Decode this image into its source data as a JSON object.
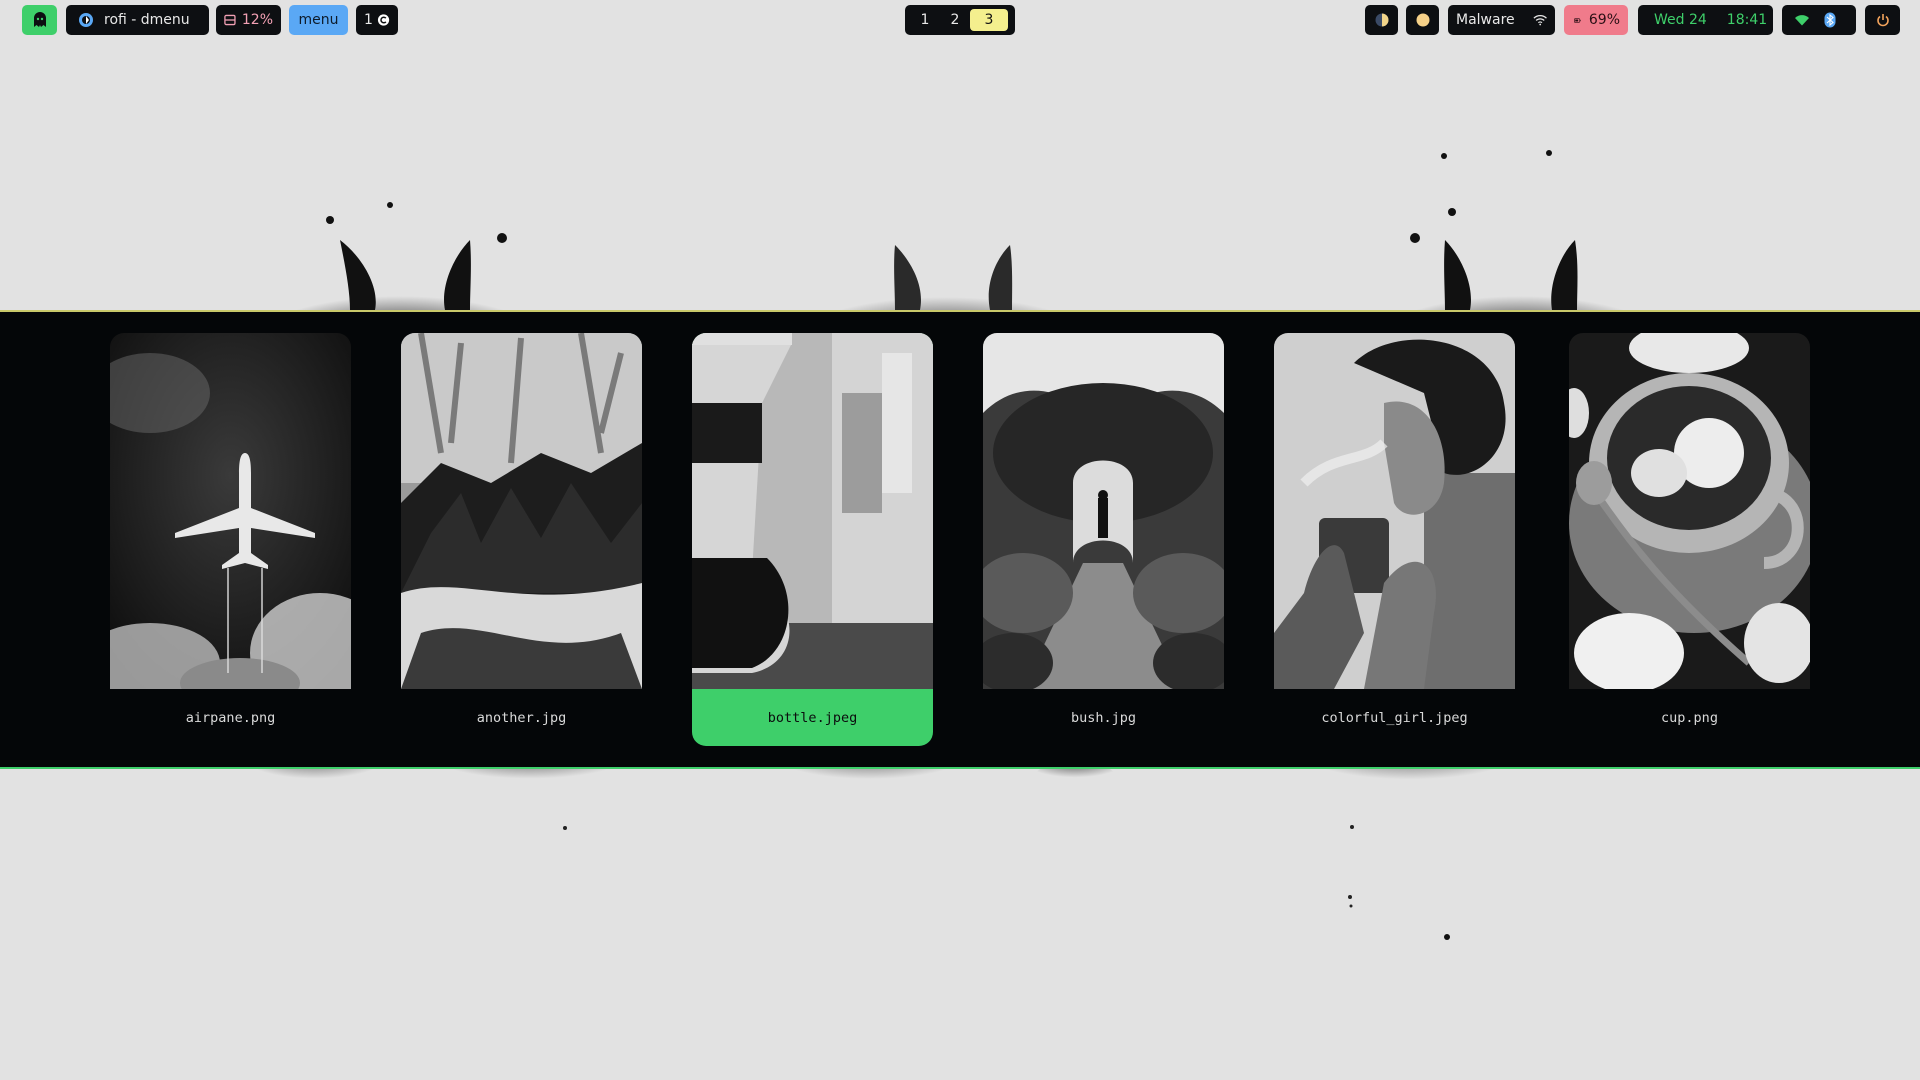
{
  "topbar": {
    "launcher_icon": "ghost-icon",
    "window": {
      "icon": "app-icon",
      "title": "rofi - dmenu"
    },
    "memory": {
      "icon": "memory-icon",
      "value": "12%"
    },
    "menu_label": "menu",
    "updates": {
      "count": "1",
      "icon": "updates-icon"
    },
    "workspaces": [
      {
        "label": "1",
        "active": false
      },
      {
        "label": "2",
        "active": false
      },
      {
        "label": "3",
        "active": true
      }
    ],
    "theme_icon": "half-circle-icon",
    "night_icon": "sun-dot-icon",
    "network": {
      "name": "Malware",
      "icon": "wifi-icon"
    },
    "battery": {
      "icon": "battery-icon",
      "value": "69%"
    },
    "clock": {
      "icon": "clock-icon",
      "date": "Wed 24",
      "time": "18:41"
    },
    "connectivity": {
      "wifi_icon": "wifi-icon",
      "bluetooth_icon": "bluetooth-icon"
    },
    "power_icon": "power-icon"
  },
  "colors": {
    "accent_green": "#3ecf6a",
    "accent_blue": "#5aa8f5",
    "accent_yellow": "#f4ef8e",
    "accent_red": "#f07b8b",
    "bar_bg": "#0d0f12",
    "wallpaper": "#e2e2e2"
  },
  "rofi": {
    "items": [
      {
        "label": "airpane.png",
        "selected": false
      },
      {
        "label": "another.jpg",
        "selected": false
      },
      {
        "label": "bottle.jpeg",
        "selected": true
      },
      {
        "label": "bush.jpg",
        "selected": false
      },
      {
        "label": "colorful_girl.jpeg",
        "selected": false
      },
      {
        "label": "cup.png",
        "selected": false
      }
    ]
  }
}
